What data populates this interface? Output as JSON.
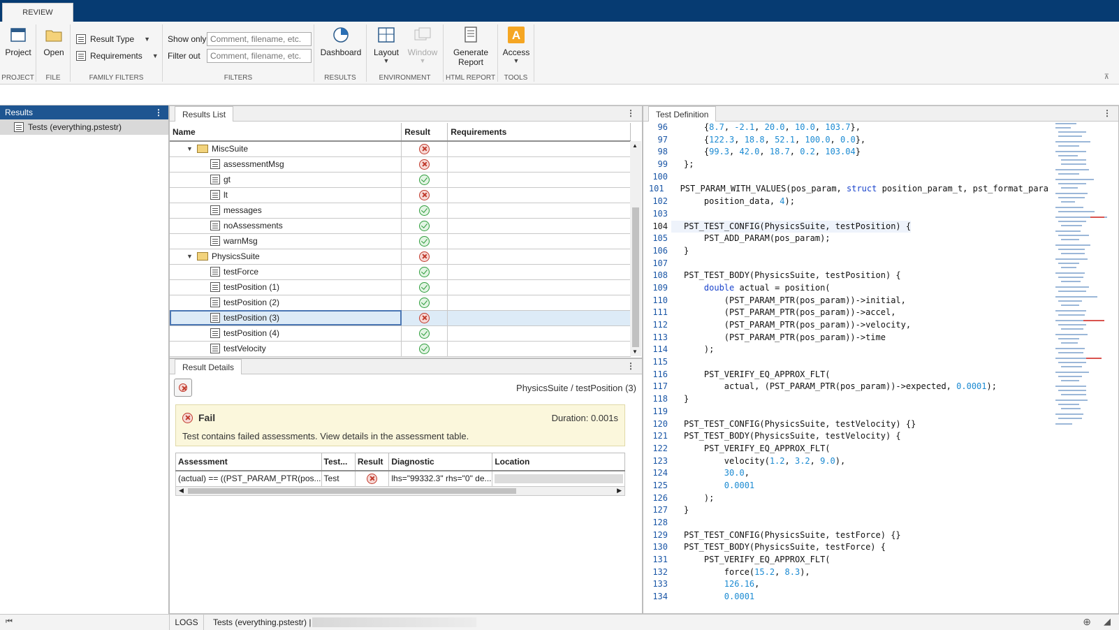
{
  "ribbon_tab": "REVIEW",
  "groups": {
    "project": {
      "label": "PROJECT",
      "button": "Project"
    },
    "file": {
      "label": "FILE",
      "button": "Open"
    },
    "family_filters": {
      "label": "FAMILY FILTERS",
      "result_type": "Result Type",
      "requirements": "Requirements"
    },
    "filters": {
      "label": "FILTERS",
      "show_only": "Show only",
      "filter_out": "Filter out",
      "placeholder": "Comment, filename, etc."
    },
    "results": {
      "label": "RESULTS",
      "button": "Dashboard"
    },
    "environment": {
      "label": "ENVIRONMENT",
      "layout": "Layout",
      "window": "Window"
    },
    "html_report": {
      "label": "HTML REPORT",
      "button_line1": "Generate",
      "button_line2": "Report"
    },
    "tools": {
      "label": "TOOLS",
      "button": "Access"
    }
  },
  "left_panel": {
    "title": "Results",
    "item": "Tests (everything.pstestr)"
  },
  "results_list": {
    "tab": "Results List",
    "columns": [
      "Name",
      "Result",
      "Requirements"
    ],
    "rows": [
      {
        "name": "MiscSuite",
        "kind": "suite",
        "result": "fail"
      },
      {
        "name": "assessmentMsg",
        "kind": "test",
        "result": "fail"
      },
      {
        "name": "gt",
        "kind": "test",
        "result": "pass"
      },
      {
        "name": "lt",
        "kind": "test",
        "result": "fail"
      },
      {
        "name": "messages",
        "kind": "test",
        "result": "pass"
      },
      {
        "name": "noAssessments",
        "kind": "test",
        "result": "pass"
      },
      {
        "name": "warnMsg",
        "kind": "test",
        "result": "pass"
      },
      {
        "name": "PhysicsSuite",
        "kind": "suite",
        "result": "fail"
      },
      {
        "name": "testForce",
        "kind": "test",
        "result": "pass"
      },
      {
        "name": "testPosition (1)",
        "kind": "test",
        "result": "pass"
      },
      {
        "name": "testPosition (2)",
        "kind": "test",
        "result": "pass"
      },
      {
        "name": "testPosition (3)",
        "kind": "test",
        "result": "fail",
        "selected": true
      },
      {
        "name": "testPosition (4)",
        "kind": "test",
        "result": "pass"
      },
      {
        "name": "testVelocity",
        "kind": "test",
        "result": "pass"
      }
    ]
  },
  "result_details": {
    "tab": "Result Details",
    "path": "PhysicsSuite / testPosition (3)",
    "status": "Fail",
    "duration": "Duration: 0.001s",
    "message": "Test contains failed assessments. View details in the assessment table.",
    "columns": [
      "Assessment",
      "Test...",
      "Result",
      "Diagnostic",
      "Location"
    ],
    "row": {
      "assessment": "(actual) == ((PST_PARAM_PTR(pos...",
      "test": "Test",
      "result": "fail",
      "diagnostic": "lhs=\"99332.3\" rhs=\"0\" de..."
    }
  },
  "test_definition": {
    "tab": "Test Definition",
    "current_line": 104,
    "lines": [
      {
        "n": "96",
        "t": "    {8.7, -2.1, 20.0, 10.0, 103.7},"
      },
      {
        "n": "97",
        "t": "    {122.3, 18.8, 52.1, 100.0, 0.0},"
      },
      {
        "n": "98",
        "t": "    {99.3, 42.0, 18.7, 0.2, 103.04}"
      },
      {
        "n": "99",
        "t": "};"
      },
      {
        "n": "100",
        "t": ""
      },
      {
        "n": "101",
        "t": "PST_PARAM_WITH_VALUES(pos_param, struct position_param_t, pst_format_para"
      },
      {
        "n": "102",
        "t": "    position_data, 4);"
      },
      {
        "n": "103",
        "t": ""
      },
      {
        "n": "104",
        "t": "PST_TEST_CONFIG(PhysicsSuite, testPosition) {"
      },
      {
        "n": "105",
        "t": "    PST_ADD_PARAM(pos_param);"
      },
      {
        "n": "106",
        "t": "}"
      },
      {
        "n": "107",
        "t": ""
      },
      {
        "n": "108",
        "t": "PST_TEST_BODY(PhysicsSuite, testPosition) {"
      },
      {
        "n": "109",
        "t": "    double actual = position("
      },
      {
        "n": "110",
        "t": "        (PST_PARAM_PTR(pos_param))->initial,"
      },
      {
        "n": "111",
        "t": "        (PST_PARAM_PTR(pos_param))->accel,"
      },
      {
        "n": "112",
        "t": "        (PST_PARAM_PTR(pos_param))->velocity,"
      },
      {
        "n": "113",
        "t": "        (PST_PARAM_PTR(pos_param))->time"
      },
      {
        "n": "114",
        "t": "    );"
      },
      {
        "n": "115",
        "t": ""
      },
      {
        "n": "116",
        "t": "    PST_VERIFY_EQ_APPROX_FLT("
      },
      {
        "n": "117",
        "t": "        actual, (PST_PARAM_PTR(pos_param))->expected, 0.0001);"
      },
      {
        "n": "118",
        "t": "}"
      },
      {
        "n": "119",
        "t": ""
      },
      {
        "n": "120",
        "t": "PST_TEST_CONFIG(PhysicsSuite, testVelocity) {}"
      },
      {
        "n": "121",
        "t": "PST_TEST_BODY(PhysicsSuite, testVelocity) {"
      },
      {
        "n": "122",
        "t": "    PST_VERIFY_EQ_APPROX_FLT("
      },
      {
        "n": "123",
        "t": "        velocity(1.2, 3.2, 9.0),"
      },
      {
        "n": "124",
        "t": "        30.0,"
      },
      {
        "n": "125",
        "t": "        0.0001"
      },
      {
        "n": "126",
        "t": "    );"
      },
      {
        "n": "127",
        "t": "}"
      },
      {
        "n": "128",
        "t": ""
      },
      {
        "n": "129",
        "t": "PST_TEST_CONFIG(PhysicsSuite, testForce) {}"
      },
      {
        "n": "130",
        "t": "PST_TEST_BODY(PhysicsSuite, testForce) {"
      },
      {
        "n": "131",
        "t": "    PST_VERIFY_EQ_APPROX_FLT("
      },
      {
        "n": "132",
        "t": "        force(15.2, 8.3),"
      },
      {
        "n": "133",
        "t": "        126.16,"
      },
      {
        "n": "134",
        "t": "        0.0001"
      }
    ]
  },
  "statusbar": {
    "logs": "LOGS",
    "file": "Tests (everything.pstestr) |"
  }
}
